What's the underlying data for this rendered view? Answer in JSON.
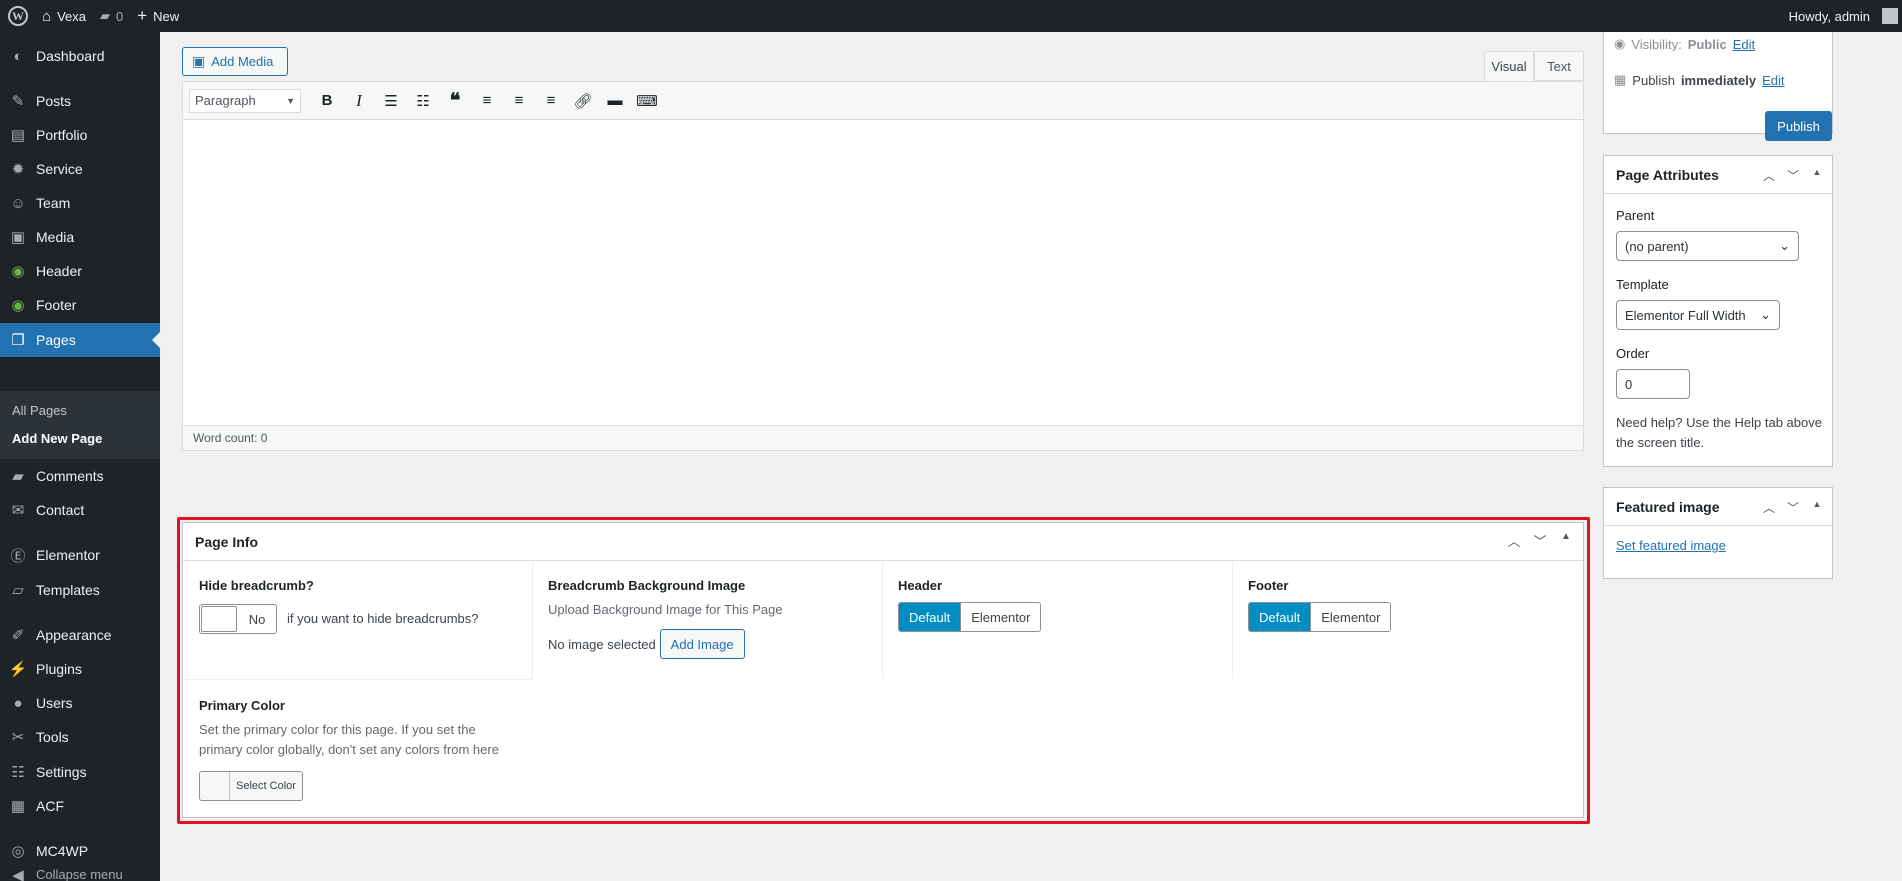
{
  "adminbar": {
    "site_name": "Vexa",
    "comments_count": "0",
    "new_label": "New",
    "howdy": "Howdy, admin"
  },
  "sidebar": {
    "items": [
      {
        "label": "Dashboard",
        "icon": "dashboard-icon"
      },
      {
        "label": "Posts",
        "icon": "pin-icon"
      },
      {
        "label": "Portfolio",
        "icon": "portfolio-icon"
      },
      {
        "label": "Service",
        "icon": "gear-icon"
      },
      {
        "label": "Team",
        "icon": "accessibility-icon"
      },
      {
        "label": "Media",
        "icon": "media-icon"
      },
      {
        "label": "Header",
        "icon": "header-icon"
      },
      {
        "label": "Footer",
        "icon": "footer-icon"
      },
      {
        "label": "Pages",
        "icon": "pages-icon"
      },
      {
        "label": "Comments",
        "icon": "comment-icon"
      },
      {
        "label": "Contact",
        "icon": "mail-icon"
      },
      {
        "label": "Elementor",
        "icon": "elementor-icon"
      },
      {
        "label": "Templates",
        "icon": "folder-icon"
      },
      {
        "label": "Appearance",
        "icon": "brush-icon"
      },
      {
        "label": "Plugins",
        "icon": "plugin-icon"
      },
      {
        "label": "Users",
        "icon": "users-icon"
      },
      {
        "label": "Tools",
        "icon": "wrench-icon"
      },
      {
        "label": "Settings",
        "icon": "settings-icon"
      },
      {
        "label": "ACF",
        "icon": "table-icon"
      },
      {
        "label": "MC4WP",
        "icon": "mc4wp-icon"
      },
      {
        "label": "Collapse menu",
        "icon": "collapse-icon"
      }
    ],
    "submenu": [
      "All Pages",
      "Add New Page"
    ]
  },
  "editor": {
    "add_media": "Add Media",
    "tab_visual": "Visual",
    "tab_text": "Text",
    "format_select": "Paragraph",
    "word_count": "Word count: 0"
  },
  "page_info": {
    "title": "Page Info",
    "hide_breadcrumb": {
      "label": "Hide breadcrumb?",
      "toggle_value": "No",
      "hint": "if you want to hide breadcrumbs?"
    },
    "breadcrumb_bg": {
      "label": "Breadcrumb Background Image",
      "desc": "Upload Background Image for This Page",
      "status": "No image selected",
      "button": "Add Image"
    },
    "header": {
      "label": "Header",
      "options": [
        "Default",
        "Elementor"
      ],
      "selected": "Default"
    },
    "footer": {
      "label": "Footer",
      "options": [
        "Default",
        "Elementor"
      ],
      "selected": "Default"
    },
    "primary_color": {
      "label": "Primary Color",
      "desc": "Set the primary color for this page. If you set the primary color globally, don't set any colors from here",
      "button": "Select Color"
    }
  },
  "publish": {
    "visibility_label": "Visibility:",
    "visibility_value": "Public",
    "visibility_edit": "Edit",
    "publish_label": "Publish",
    "publish_value": "immediately",
    "publish_edit": "Edit",
    "publish_button": "Publish"
  },
  "page_attributes": {
    "title": "Page Attributes",
    "parent_label": "Parent",
    "parent_value": "(no parent)",
    "template_label": "Template",
    "template_value": "Elementor Full Width",
    "order_label": "Order",
    "order_value": "0",
    "help": "Need help? Use the Help tab above the screen title."
  },
  "featured_image": {
    "title": "Featured image",
    "link": "Set featured image"
  },
  "colors": {
    "accent": "#2271b1",
    "segment_active": "#008ec2",
    "highlight": "#e0141e",
    "sidebar_bg": "#1d2327"
  }
}
